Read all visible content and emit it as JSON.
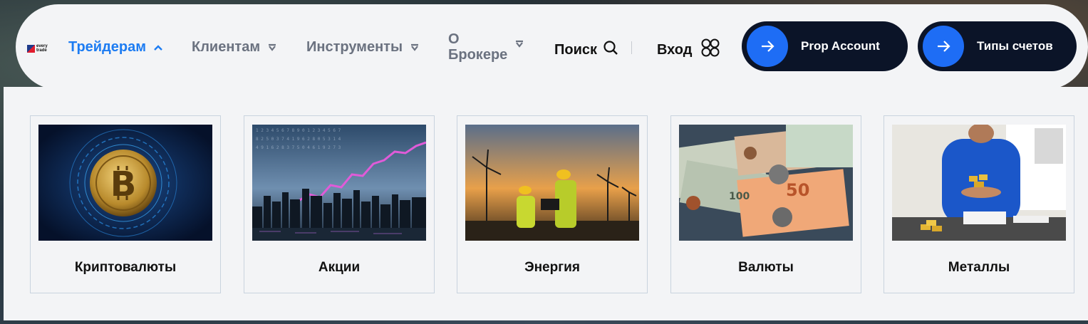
{
  "brand": {
    "logo_text": "every trade"
  },
  "nav": {
    "items": [
      {
        "label": "Трейдерам",
        "active": true
      },
      {
        "label": "Клиентам",
        "active": false
      },
      {
        "label": "Инструменты",
        "active": false
      },
      {
        "label": "О\nБрокере",
        "active": false
      }
    ],
    "search_label": "Поиск",
    "login_label": "Вход"
  },
  "buttons": {
    "prop_account": "Prop Account",
    "account_types": "Типы счетов"
  },
  "colors": {
    "active_nav": "#1d7cf2",
    "button_bg": "#0b1428",
    "button_circle": "#1e6df5"
  },
  "categories": [
    {
      "title": "Криптовалюты",
      "image": "bitcoin-image"
    },
    {
      "title": "Акции",
      "image": "city-stocks-image"
    },
    {
      "title": "Энергия",
      "image": "wind-turbines-image"
    },
    {
      "title": "Валюты",
      "image": "banknotes-image"
    },
    {
      "title": "Металлы",
      "image": "gold-bars-image"
    }
  ]
}
